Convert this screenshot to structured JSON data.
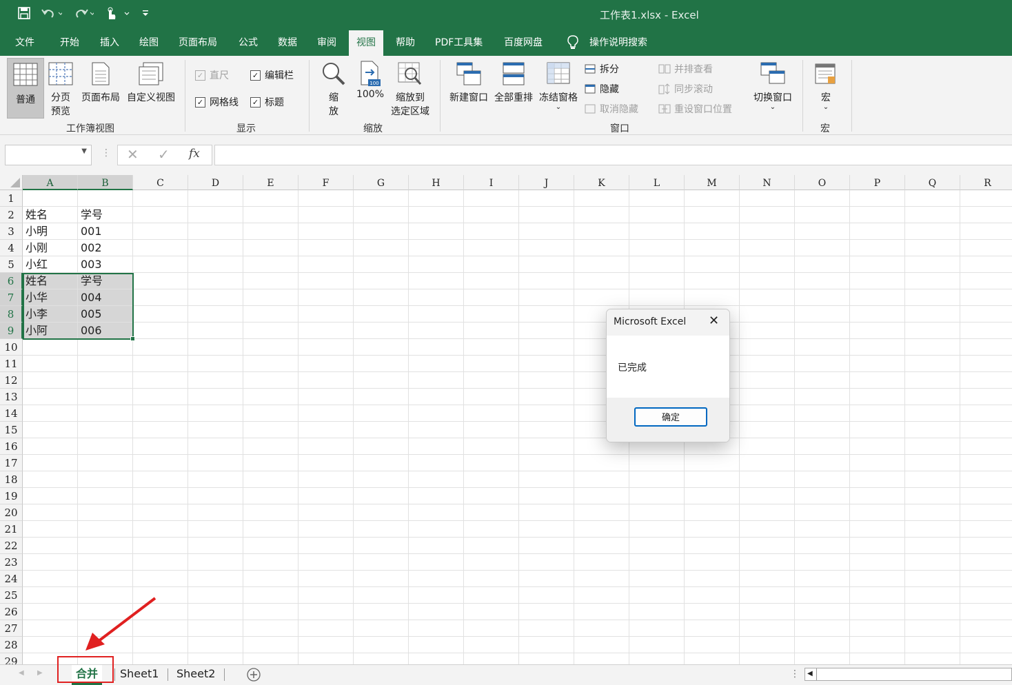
{
  "window": {
    "title": "工作表1.xlsx  -  Excel"
  },
  "quick_access": {
    "icons": [
      "save-icon",
      "undo-icon",
      "redo-icon",
      "touch-mode-icon",
      "customize-icon"
    ]
  },
  "tabs": [
    "文件",
    "开始",
    "插入",
    "绘图",
    "页面布局",
    "公式",
    "数据",
    "审阅",
    "视图",
    "帮助",
    "PDF工具集",
    "百度网盘"
  ],
  "active_tab": "视图",
  "tell_me": "操作说明搜索",
  "ribbon": {
    "workbook_views": {
      "label": "工作簿视图",
      "normal": "普通",
      "page_break_1": "分页",
      "page_break_2": "预览",
      "page_layout": "页面布局",
      "custom_views": "自定义视图"
    },
    "show": {
      "label": "显示",
      "ruler": "直尺",
      "formula_bar": "编辑栏",
      "gridlines": "网格线",
      "headings": "标题"
    },
    "zoom": {
      "label": "缩放",
      "zoom_1": "缩",
      "zoom_2": "放",
      "hundred": "100%",
      "zoom_sel_1": "缩放到",
      "zoom_sel_2": "选定区域"
    },
    "window": {
      "label": "窗口",
      "new_window": "新建窗口",
      "arrange_all": "全部重排",
      "freeze": "冻结窗格",
      "split": "拆分",
      "hide": "隐藏",
      "unhide": "取消隐藏",
      "side_by_side": "并排查看",
      "sync_scroll": "同步滚动",
      "reset_pos": "重设窗口位置",
      "switch": "切换窗口"
    },
    "macros": {
      "label": "宏",
      "macros": "宏"
    }
  },
  "formula_bar": {
    "fx": "fx",
    "name_box": "",
    "content": ""
  },
  "columns": [
    "A",
    "B",
    "C",
    "D",
    "E",
    "F",
    "G",
    "H",
    "I",
    "J",
    "K",
    "L",
    "M",
    "N",
    "O",
    "P",
    "Q",
    "R"
  ],
  "rows": [
    "1",
    "2",
    "3",
    "4",
    "5",
    "6",
    "7",
    "8",
    "9",
    "10",
    "11",
    "12",
    "13",
    "14",
    "15",
    "16",
    "17",
    "18",
    "19",
    "20",
    "21",
    "22",
    "23",
    "24",
    "25",
    "26",
    "27",
    "28",
    "29"
  ],
  "cells": [
    {
      "row": 2,
      "a": "姓名",
      "b": "学号"
    },
    {
      "row": 3,
      "a": "小明",
      "b": "001"
    },
    {
      "row": 4,
      "a": "小刚",
      "b": "002"
    },
    {
      "row": 5,
      "a": "小红",
      "b": "003"
    },
    {
      "row": 6,
      "a": "姓名",
      "b": "学号"
    },
    {
      "row": 7,
      "a": "小华",
      "b": "004"
    },
    {
      "row": 8,
      "a": "小李",
      "b": "005"
    },
    {
      "row": 9,
      "a": "小阿",
      "b": "006"
    }
  ],
  "selection": {
    "range": "A6:B9",
    "rows": [
      6,
      7,
      8,
      9
    ],
    "columns": [
      "A",
      "B"
    ]
  },
  "sheets": {
    "tabs": [
      "合并",
      "Sheet1",
      "Sheet2"
    ],
    "active": "合并"
  },
  "dialog": {
    "title": "Microsoft Excel",
    "message": "已完成",
    "ok": "确定"
  },
  "colors": {
    "excel_green": "#217346",
    "annotation_red": "#e02020",
    "dialog_button_blue": "#0067c0"
  }
}
